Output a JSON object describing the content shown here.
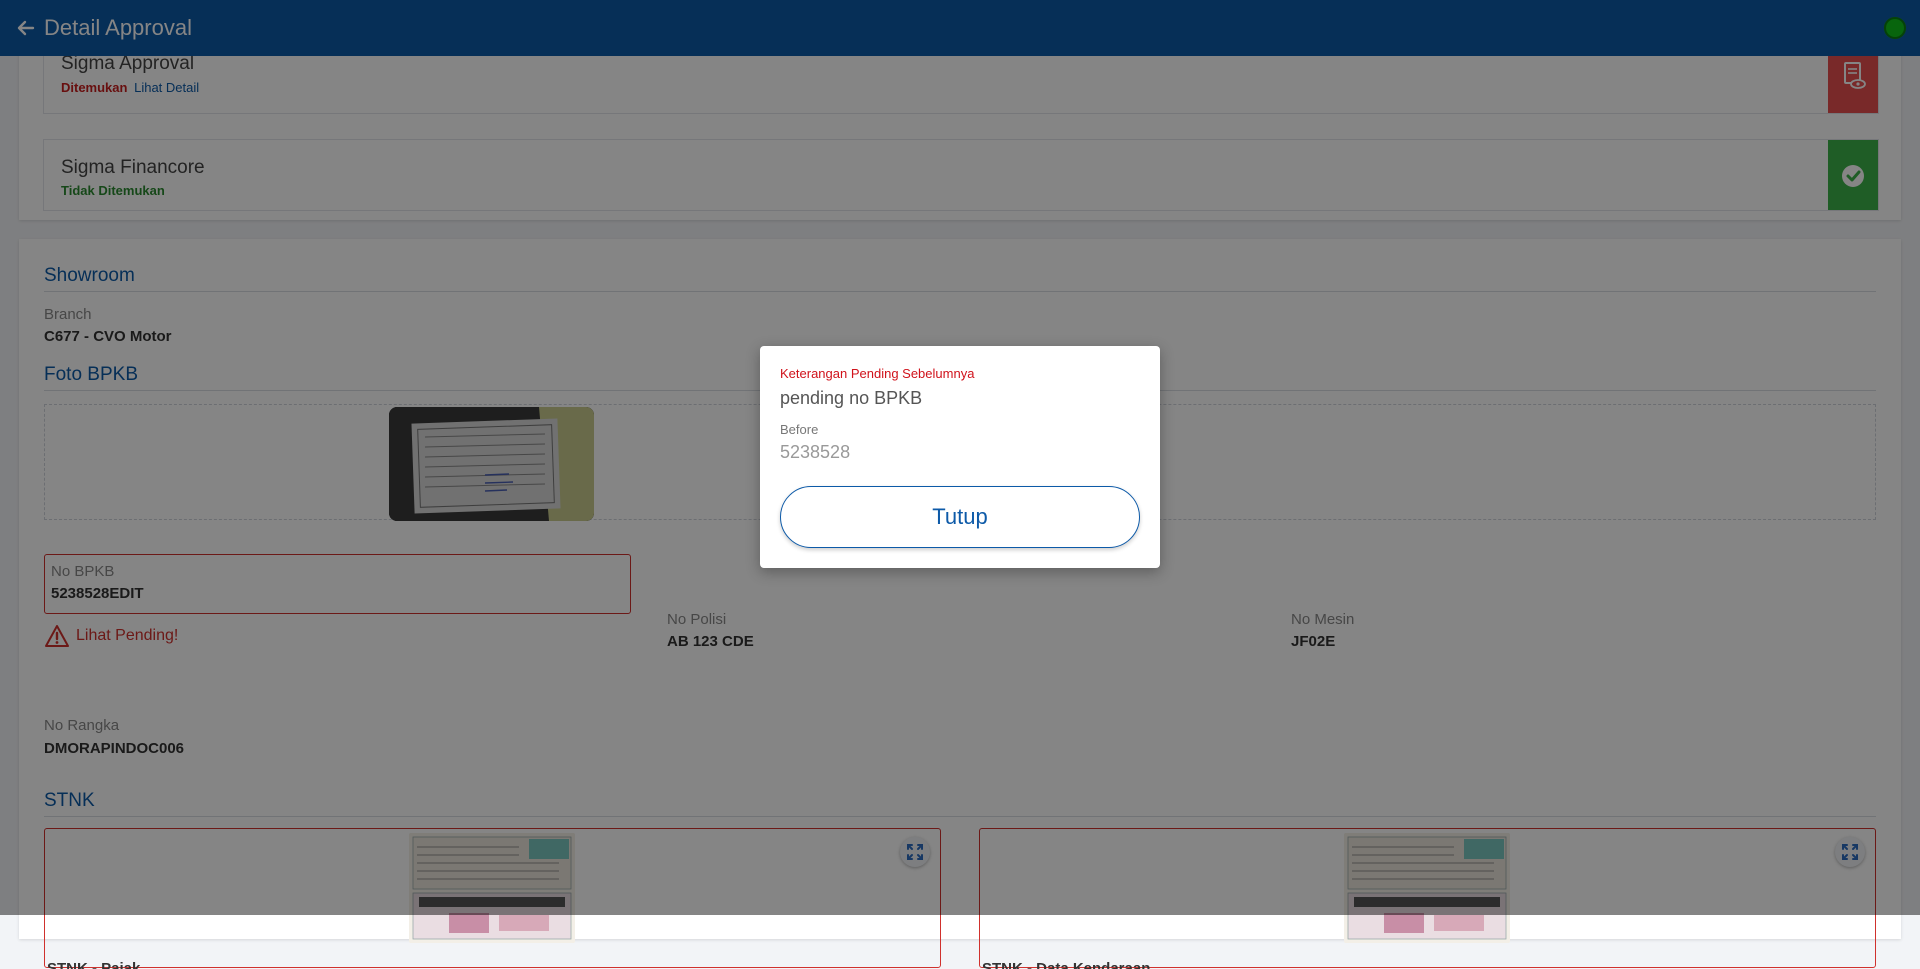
{
  "header": {
    "title": "Detail Approval"
  },
  "sigma": [
    {
      "name": "Sigma Approval",
      "status": "Ditemukan",
      "link": "Lihat Detail",
      "status_color": "#c81d1d",
      "side_color": "#e8504f",
      "icon": "document-eye-icon"
    },
    {
      "name": "Sigma Financore",
      "status": "Tidak Ditemukan",
      "status_color": "#2b8a30",
      "side_color": "#3db24a",
      "icon": "check-circle-icon"
    }
  ],
  "showroom": {
    "title": "Showroom",
    "branch_label": "Branch",
    "branch_value": "C677 - CVO Motor"
  },
  "foto_bpkb": {
    "title": "Foto BPKB"
  },
  "bpkb": {
    "no_bpkb_label": "No BPKB",
    "no_bpkb_value": "5238528EDIT",
    "pending_link": "Lihat Pending!",
    "no_polisi_label": "No Polisi",
    "no_polisi_value": "AB 123 CDE",
    "no_mesin_label": "No Mesin",
    "no_mesin_value": "JF02E",
    "no_rangka_label": "No Rangka",
    "no_rangka_value": "DMORAPINDOC006"
  },
  "stnk": {
    "title": "STNK",
    "cards": [
      {
        "caption": "STNK - Pajak"
      },
      {
        "caption": "STNK - Data Kendaraan"
      }
    ]
  },
  "modal": {
    "heading": "Keterangan Pending Sebelumnya",
    "note": "pending no BPKB",
    "before_label": "Before",
    "before_value": "5238528",
    "close_label": "Tutup"
  },
  "colors": {
    "primary": "#0d5aa8",
    "danger": "#d0312d",
    "success": "#3db24a",
    "status_dot": "#11c21a"
  }
}
